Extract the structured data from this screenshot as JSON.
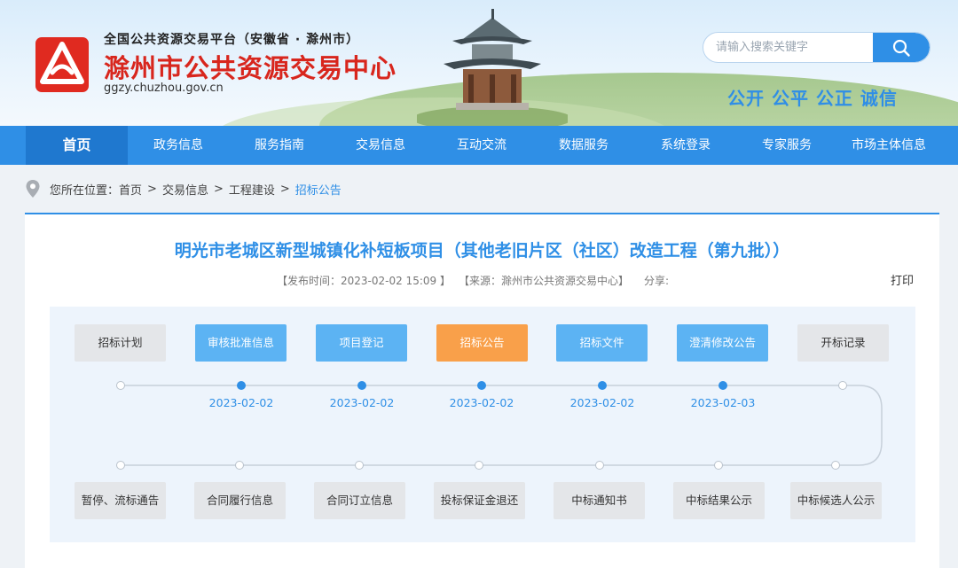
{
  "header": {
    "platform_line": "全国公共资源交易平台（安徽省 · 滁州市）",
    "center_name": "滁州市公共资源交易中心",
    "domain": "ggzy.chuzhou.gov.cn",
    "search_placeholder": "请输入搜索关键字",
    "slogan": "公开  公平  公正  诚信",
    "icons": {
      "logo": "logo-mark-icon",
      "search": "search-icon"
    }
  },
  "nav": {
    "items": [
      {
        "label": "首页"
      },
      {
        "label": "政务信息"
      },
      {
        "label": "服务指南"
      },
      {
        "label": "交易信息"
      },
      {
        "label": "互动交流"
      },
      {
        "label": "数据服务"
      },
      {
        "label": "系统登录"
      },
      {
        "label": "专家服务"
      },
      {
        "label": "市场主体信息"
      }
    ],
    "active_index": 0
  },
  "breadcrumb": {
    "prefix": "您所在位置：",
    "items": [
      "首页",
      "交易信息",
      "工程建设",
      "招标公告"
    ],
    "separator": ">"
  },
  "article": {
    "title": "明光市老城区新型城镇化补短板项目（其他老旧片区（社区）改造工程（第九批））",
    "publish_time": "【发布时间：2023-02-02 15:09 】",
    "source": "【来源：滁州市公共资源交易中心】",
    "share_label": "分享:",
    "print_label": "打印"
  },
  "process": {
    "top_steps": [
      {
        "label": "招标计划",
        "state": "grey",
        "date": ""
      },
      {
        "label": "审核批准信息",
        "state": "blue",
        "date": "2023-02-02"
      },
      {
        "label": "项目登记",
        "state": "blue",
        "date": "2023-02-02"
      },
      {
        "label": "招标公告",
        "state": "orange",
        "date": "2023-02-02"
      },
      {
        "label": "招标文件",
        "state": "blue",
        "date": "2023-02-02"
      },
      {
        "label": "澄清修改公告",
        "state": "blue",
        "date": "2023-02-03"
      },
      {
        "label": "开标记录",
        "state": "grey",
        "date": ""
      }
    ],
    "bottom_steps": [
      {
        "label": "暂停、流标通告"
      },
      {
        "label": "合同履行信息"
      },
      {
        "label": "合同订立信息"
      },
      {
        "label": "投标保证金退还"
      },
      {
        "label": "中标通知书"
      },
      {
        "label": "中标结果公示"
      },
      {
        "label": "中标候选人公示"
      }
    ],
    "colors": {
      "active": "#2f8fe6",
      "current": "#f9a04a",
      "inactive": "#e4e6e9"
    }
  }
}
